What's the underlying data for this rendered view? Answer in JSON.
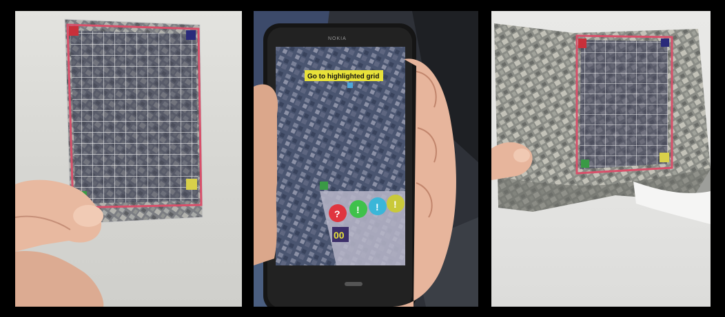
{
  "photos": [
    {
      "name": "hand-holding-paper-map-with-grid"
    },
    {
      "name": "hand-holding-phone-showing-ar-grid"
    },
    {
      "name": "folded-paper-map-with-grid"
    }
  ],
  "phone": {
    "brand": "NOKIA",
    "banner_text": "Go to highlighted grid",
    "counter_glyph": "00",
    "buttons": [
      {
        "glyph": "?",
        "color": "#e0353f"
      },
      {
        "glyph": "!",
        "color": "#3fc14b"
      },
      {
        "glyph": "!",
        "color": "#3bb6d8"
      },
      {
        "glyph": "!",
        "color": "#c9c93a"
      }
    ]
  },
  "marker_colors": {
    "red": "#c9303a",
    "blue": "#2a2a7a",
    "green": "#3a9a45",
    "yellow": "#d8d04a",
    "border": "#d8506a"
  }
}
